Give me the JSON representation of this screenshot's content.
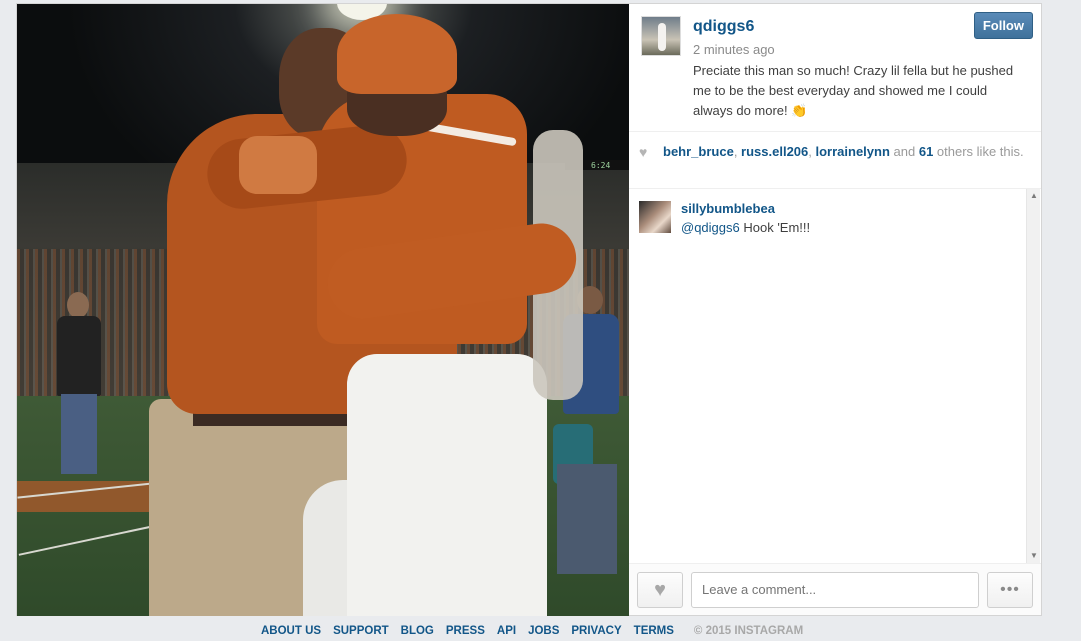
{
  "post": {
    "owner": "qdiggs6",
    "time": "2 minutes ago",
    "caption": "Preciate this man so much! Crazy lil fella but he pushed me to be the best everyday and showed me I could always do more! 👏",
    "follow_label": "Follow"
  },
  "photo": {
    "scoreboard_text": "6:24"
  },
  "likes": {
    "users": [
      "behr_bruce",
      "russ.ell206",
      "lorrainelynn"
    ],
    "sep1": ", ",
    "sep2": ", ",
    "and_text": " and ",
    "count": "61",
    "tail": " others like this."
  },
  "comments": [
    {
      "user": "sillybumblebea",
      "mention": "@qdiggs6",
      "text": " Hook 'Em!!!"
    }
  ],
  "comment_box": {
    "placeholder": "Leave a comment...",
    "more_label": "•••"
  },
  "footer": {
    "links": [
      "ABOUT US",
      "SUPPORT",
      "BLOG",
      "PRESS",
      "API",
      "JOBS",
      "PRIVACY",
      "TERMS"
    ],
    "copyright": "© 2015 INSTAGRAM"
  },
  "colors": {
    "link": "#125688",
    "follow_button": "#3f729b",
    "background": "#e9ebee"
  },
  "icons": {
    "like": "heart-icon",
    "more": "ellipsis-icon"
  }
}
